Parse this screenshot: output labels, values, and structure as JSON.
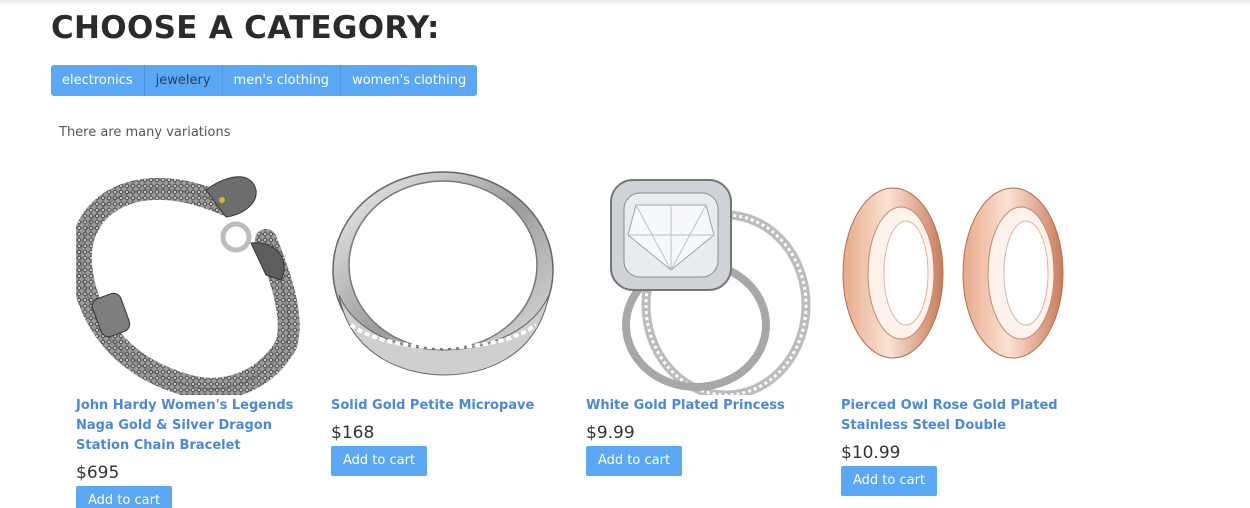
{
  "page": {
    "heading": "CHOOSE A CATEGORY:",
    "intro": "There are many variations"
  },
  "categories": [
    {
      "label": "electronics",
      "active": false
    },
    {
      "label": "jewelery",
      "active": true
    },
    {
      "label": "men's clothing",
      "active": false
    },
    {
      "label": "women's clothing",
      "active": false
    }
  ],
  "colors": {
    "accent": "#5aa7f5",
    "link": "#4a88e0"
  },
  "products": [
    {
      "title": "John Hardy Women's Legends Naga Gold & Silver Dragon Station Chain Bracelet",
      "price": "$695",
      "cart_label": "Add to cart",
      "image": "dragon-chain-bracelet-image"
    },
    {
      "title": "Solid Gold Petite Micropave",
      "price": "$168",
      "cart_label": "Add to cart",
      "image": "silver-band-ring-image"
    },
    {
      "title": "White Gold Plated Princess",
      "price": "$9.99",
      "cart_label": "Add to cart",
      "image": "diamond-ring-set-image"
    },
    {
      "title": "Pierced Owl Rose Gold Plated Stainless Steel Double",
      "price": "$10.99",
      "cart_label": "Add to cart",
      "image": "rose-gold-tunnels-image"
    }
  ]
}
